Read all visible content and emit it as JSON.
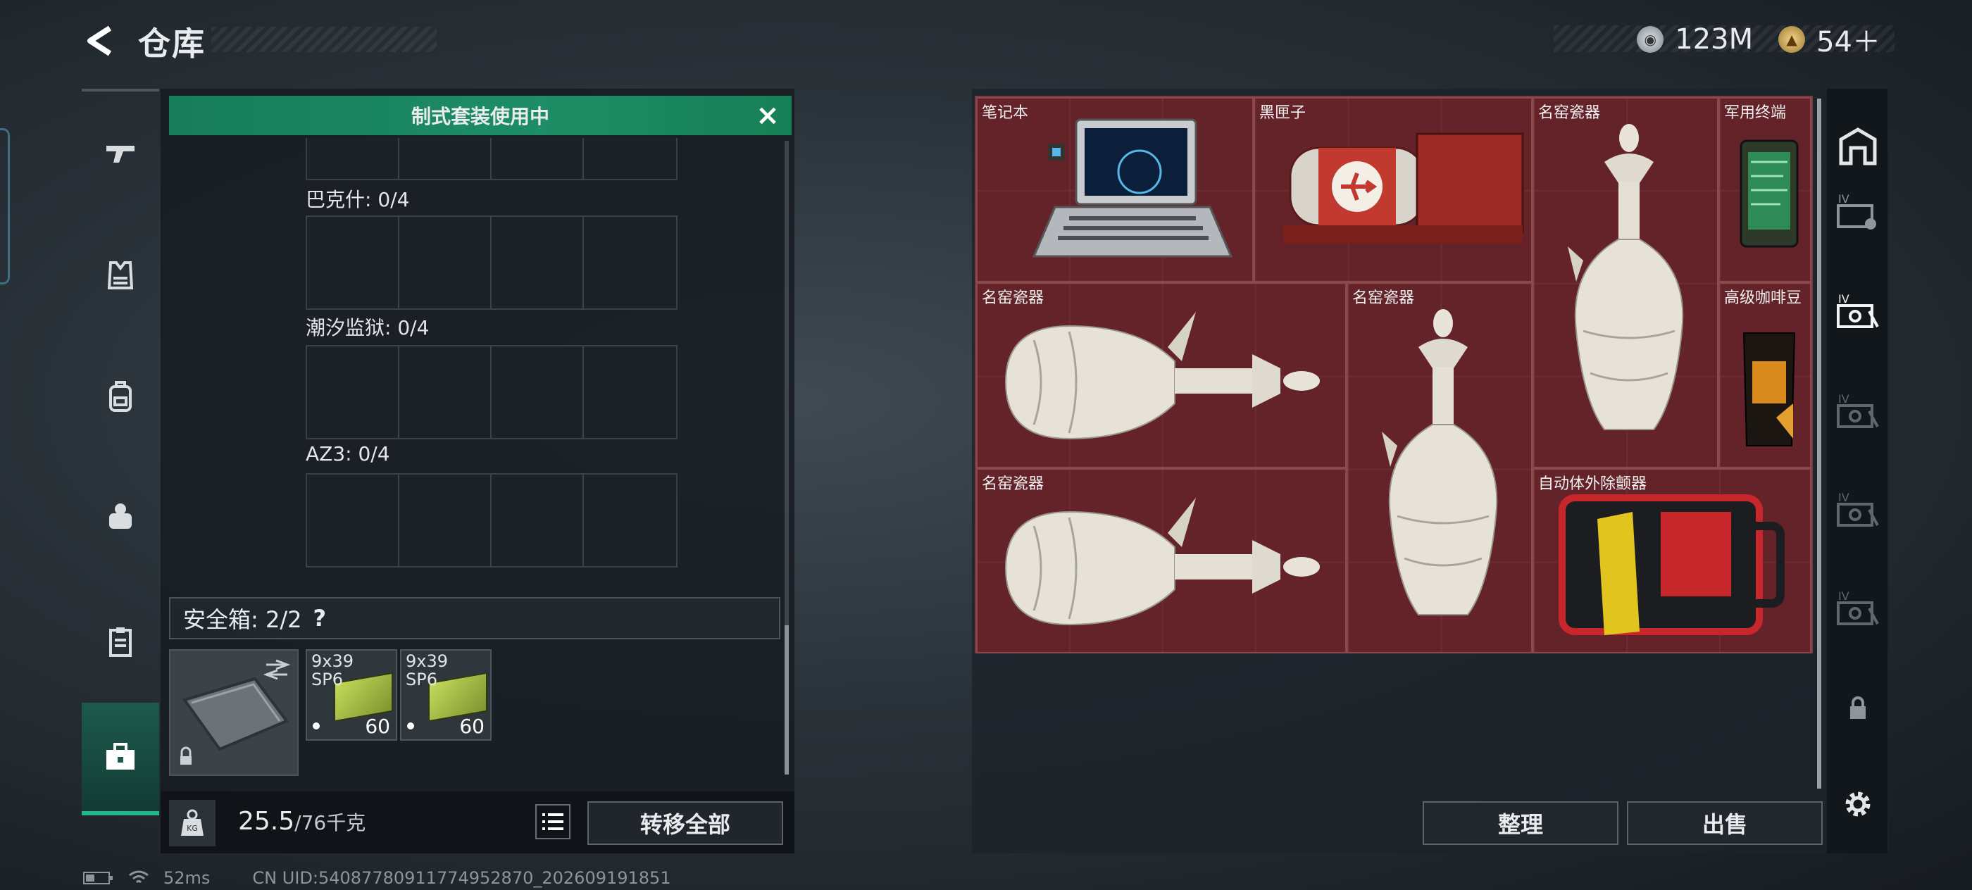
{
  "header": {
    "title": "仓库",
    "currency": [
      {
        "icon": "silver-coin-icon",
        "value": "123M"
      },
      {
        "icon": "gold-coin-icon",
        "value": "54＋"
      }
    ]
  },
  "left_nav": {
    "items": [
      {
        "name": "gun-icon",
        "active": false
      },
      {
        "name": "armor-vest-icon",
        "active": false
      },
      {
        "name": "backpack-icon",
        "active": false
      },
      {
        "name": "chest-rig-icon",
        "active": false
      },
      {
        "name": "clipboard-icon",
        "active": false
      },
      {
        "name": "toolbox-icon",
        "active": true
      }
    ]
  },
  "loadout": {
    "banner": "制式套装使用中",
    "groups": [
      {
        "label": "巴克什: 0/4"
      },
      {
        "label": "潮汐监狱: 0/4"
      },
      {
        "label": "AZ3: 0/4"
      }
    ],
    "safe_box": {
      "label": "安全箱:  2/2",
      "help": "?"
    },
    "ammo": [
      {
        "caliber": "9x39\nSP6",
        "count": "60"
      },
      {
        "caliber": "9x39\nSP6",
        "count": "60"
      }
    ],
    "weight": {
      "current": "25.5",
      "max": "/76千克"
    },
    "transfer_all": "转移全部"
  },
  "inventory": {
    "items": [
      {
        "name": "笔记本"
      },
      {
        "name": "黑匣子"
      },
      {
        "name": "名窑瓷器"
      },
      {
        "name": "军用终端"
      },
      {
        "name": "名窑瓷器"
      },
      {
        "name": "名窑瓷器"
      },
      {
        "name": "高级咖啡豆"
      },
      {
        "name": "名窑瓷器"
      },
      {
        "name": "自动体外除颤器"
      }
    ],
    "sort": "整理",
    "sell": "出售"
  },
  "status_bar": {
    "ping": "52ms",
    "uid": "CN UID:540877809117749528​70_202609191851"
  },
  "colors": {
    "accent_green": "#1d8d66",
    "item_bg": "#5a1e23"
  }
}
